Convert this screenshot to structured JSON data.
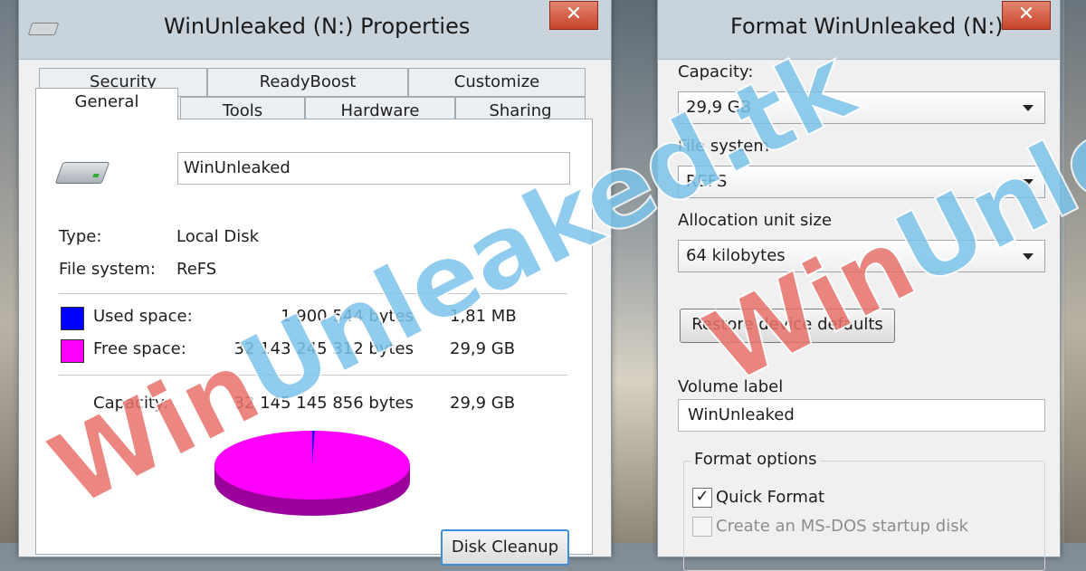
{
  "colors": {
    "used_space": "#0000ff",
    "free_space": "#ff00ff",
    "pie_side": "#9b009b",
    "close_button": "#c8432b",
    "watermark_red": "#e8726b",
    "watermark_blue": "#7cc4ea"
  },
  "properties": {
    "title": "WinUnleaked (N:) Properties",
    "close_glyph": "✕",
    "tabs_row1": [
      "Security",
      "ReadyBoost",
      "Customize"
    ],
    "tabs_row2": [
      "General",
      "Tools",
      "Hardware",
      "Sharing"
    ],
    "active_tab": "General",
    "drive_name": "WinUnleaked",
    "type_label": "Type:",
    "type_value": "Local Disk",
    "fs_label": "File system:",
    "fs_value": "ReFS",
    "used_label": "Used space:",
    "used_bytes": "1 900 544 bytes",
    "used_size": "1,81 MB",
    "free_label": "Free space:",
    "free_bytes": "32 143 245 312 bytes",
    "free_size": "29,9 GB",
    "capacity_label": "Capacity:",
    "capacity_bytes": "32 145 145 856 bytes",
    "capacity_size": "29,9 GB",
    "disk_cleanup_label": "Disk Cleanup",
    "usage_fraction": {
      "used": 5.9e-05,
      "free": 0.999941
    }
  },
  "format": {
    "title": "Format WinUnleaked (N:)",
    "close_glyph": "✕",
    "capacity_label": "Capacity:",
    "capacity_value": "29,9 GB",
    "fs_label": "File system",
    "fs_value": "REFS",
    "alloc_label": "Allocation unit size",
    "alloc_value": "64 kilobytes",
    "restore_label": "Restore device defaults",
    "volume_label_label": "Volume label",
    "volume_label_value": "WinUnleaked",
    "format_options_label": "Format options",
    "quick_format_label": "Quick Format",
    "quick_format_checked": true,
    "msdos_label": "Create an MS-DOS startup disk",
    "msdos_checked": false
  },
  "watermark": {
    "part1": "Win",
    "part2": "Unleaked.tk"
  },
  "icons": {
    "drive": "drive-icon",
    "close": "close-icon",
    "dropdown": "chevron-down-icon",
    "check": "checkmark-icon"
  }
}
